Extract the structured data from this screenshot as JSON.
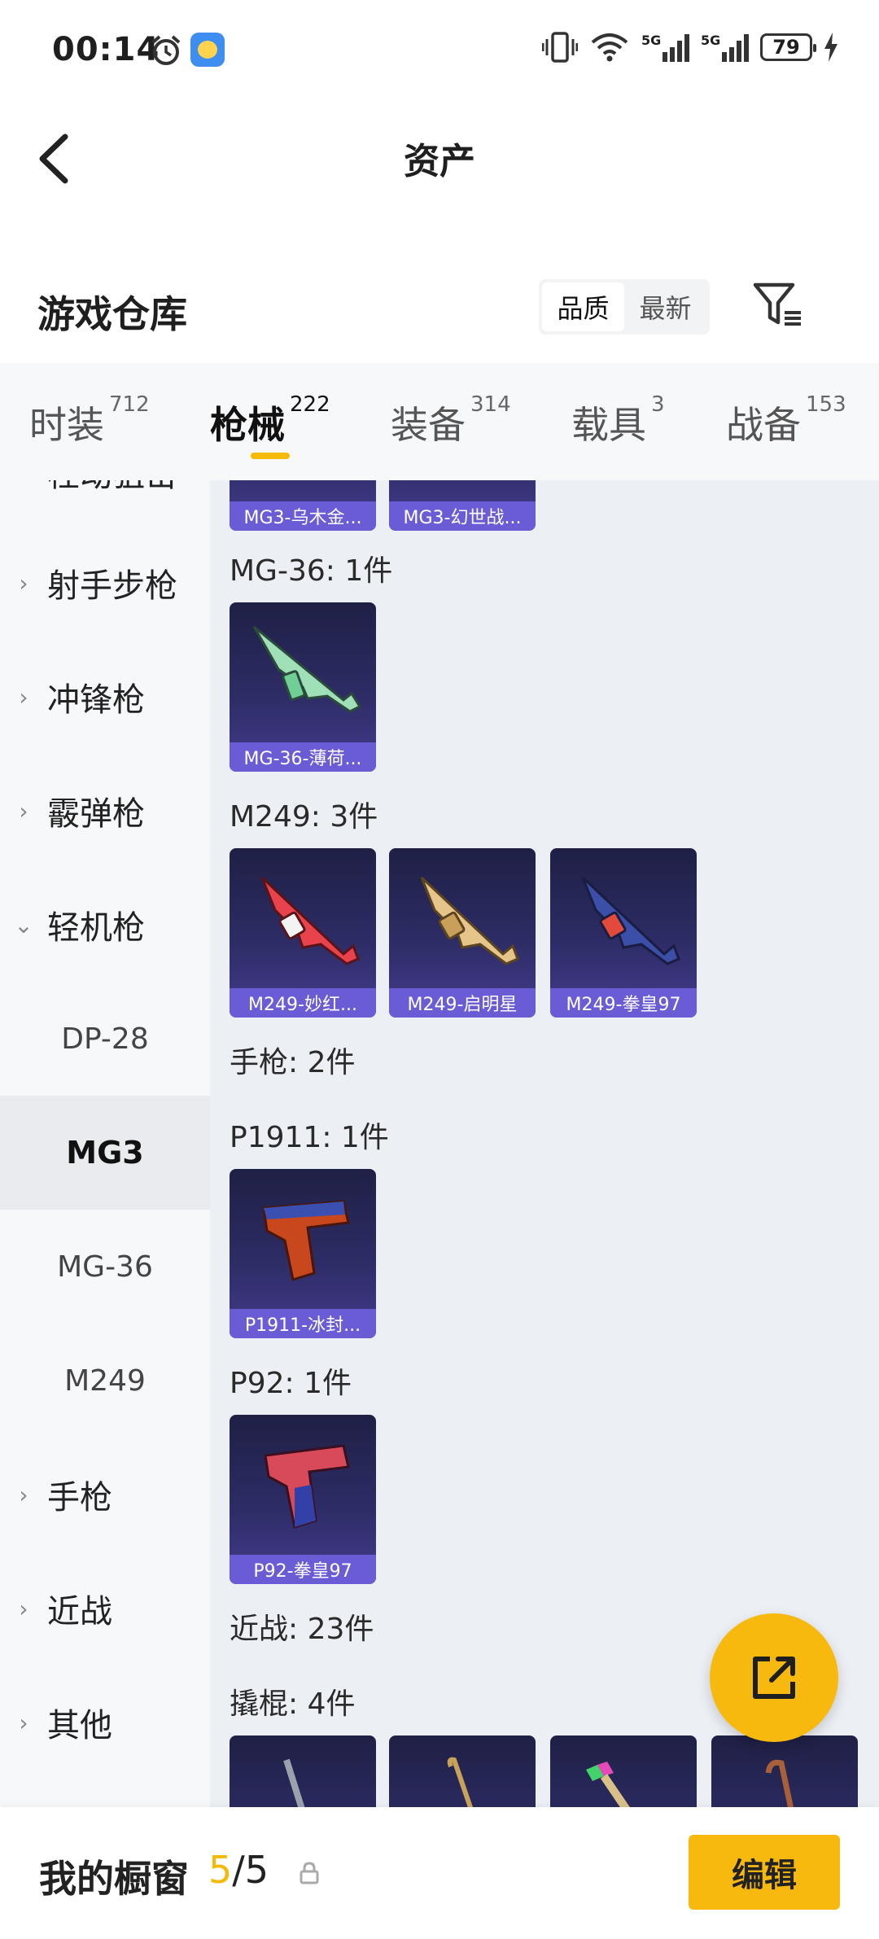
{
  "status_bar": {
    "time": "00:14",
    "battery": "79"
  },
  "header": {
    "title": "资产"
  },
  "section": {
    "title": "游戏仓库",
    "sort_options": [
      "品质",
      "最新"
    ],
    "sort_selected": "品质"
  },
  "tabs": [
    {
      "label": "时装",
      "count": "712"
    },
    {
      "label": "枪械",
      "count": "222"
    },
    {
      "label": "装备",
      "count": "314"
    },
    {
      "label": "载具",
      "count": "3"
    },
    {
      "label": "战备",
      "count": "153"
    }
  ],
  "nav": {
    "items": [
      "栓动狙击",
      "射手步枪",
      "冲锋枪",
      "霰弹枪",
      "轻机枪"
    ],
    "subitems": [
      "DP-28",
      "MG3",
      "MG-36",
      "M249"
    ],
    "items_after": [
      "手枪",
      "近战",
      "其他"
    ],
    "selected": "MG3"
  },
  "content": {
    "mg3_items": [
      "MG3-乌木金...",
      "MG3-幻世战..."
    ],
    "mg36_label": "MG-36: 1件",
    "mg36_items": [
      "MG-36-薄荷..."
    ],
    "m249_label": "M249: 3件",
    "m249_items": [
      "M249-妙红...",
      "M249-启明星",
      "M249-拳皇97"
    ],
    "pistol_label": "手枪: 2件",
    "p1911_label": "P1911: 1件",
    "p1911_items": [
      "P1911-冰封..."
    ],
    "p92_label": "P92: 1件",
    "p92_items": [
      "P92-拳皇97"
    ],
    "melee_label": "近战: 23件",
    "crowbar_label": "撬棍: 4件"
  },
  "bottom_bar": {
    "title": "我的橱窗",
    "count_current": "5",
    "count_total": "/5",
    "edit_label": "编辑"
  },
  "colors": {
    "accent": "#f8b90f",
    "card_caption": "#6a5cd4"
  }
}
